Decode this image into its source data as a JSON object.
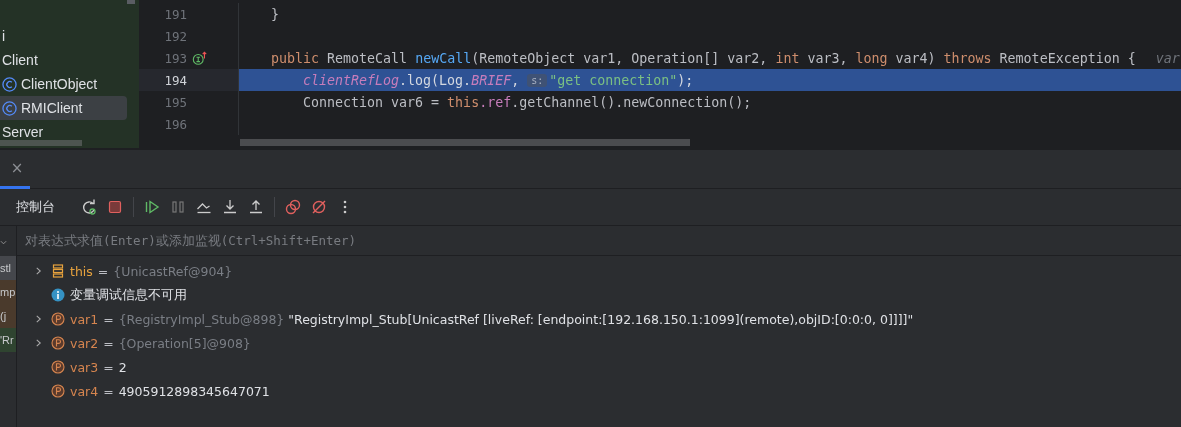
{
  "project_tree": {
    "items": [
      {
        "label": "i",
        "kind": "package",
        "selected": false
      },
      {
        "label": "Client",
        "kind": "package",
        "selected": false
      },
      {
        "label": "ClientObject",
        "kind": "class",
        "selected": false
      },
      {
        "label": "RMIClient",
        "kind": "class",
        "selected": true
      },
      {
        "label": "Server",
        "kind": "package",
        "selected": false
      }
    ]
  },
  "editor": {
    "lines": [
      {
        "number": "191",
        "current": false,
        "marker": false,
        "indent": false,
        "tokens": [
          {
            "kind": "plain",
            "text": "}"
          }
        ]
      },
      {
        "number": "192",
        "current": false,
        "marker": false,
        "indent": false
      },
      {
        "number": "193",
        "current": false,
        "marker": true,
        "indent": false,
        "tokens": [
          {
            "kind": "keyword",
            "text": "public"
          },
          {
            "kind": "plain",
            "text": " RemoteCall "
          },
          {
            "kind": "method",
            "text": "newCall"
          },
          {
            "kind": "plain",
            "text": "(RemoteObject var1, Operation[] var2, "
          },
          {
            "kind": "keyword",
            "text": "int"
          },
          {
            "kind": "plain",
            "text": " var3, "
          },
          {
            "kind": "keyword",
            "text": "long"
          },
          {
            "kind": "plain",
            "text": " var4) "
          },
          {
            "kind": "keyword",
            "text": "throws"
          },
          {
            "kind": "plain",
            "text": " RemoteException {"
          },
          {
            "kind": "hint",
            "text": "var"
          }
        ]
      },
      {
        "number": "194",
        "current": true,
        "marker": false,
        "indent": true,
        "tokens": [
          {
            "kind": "static",
            "text": "clientRefLog"
          },
          {
            "kind": "plain",
            "text": ".log(Log."
          },
          {
            "kind": "static",
            "text": "BRIEF"
          },
          {
            "kind": "plain",
            "text": ", "
          },
          {
            "kind": "badge",
            "text": "s:"
          },
          {
            "kind": "string",
            "text": "\"get connection\""
          },
          {
            "kind": "plain",
            "text": ");"
          }
        ]
      },
      {
        "number": "195",
        "current": false,
        "marker": false,
        "indent": true,
        "tokens": [
          {
            "kind": "plain",
            "text": "Connection var6 = "
          },
          {
            "kind": "keyword",
            "text": "this"
          },
          {
            "kind": "field",
            "text": ".ref"
          },
          {
            "kind": "plain",
            "text": ".getChannel().newConnection();"
          }
        ]
      },
      {
        "number": "196",
        "current": false,
        "marker": false,
        "indent": false
      }
    ]
  },
  "debug_panel": {
    "close": "×",
    "console_tab": "控制台",
    "evaluate_field": {
      "placeholder": "对表达式求值(Enter)或添加监视(Ctrl+Shift+Enter)"
    },
    "frames": [
      {
        "label": "stl",
        "color": "#45474c"
      },
      {
        "label": "mp",
        "color": "#4a3a2c"
      },
      {
        "label": "(j",
        "color": "#4a3a2c"
      },
      {
        "label": "'Rr",
        "color": "#2f4430"
      }
    ],
    "variables": [
      {
        "kind": "object",
        "expandable": true,
        "name": "this",
        "equals": "=",
        "type": "{UnicastRef@904}"
      },
      {
        "kind": "info",
        "expandable": false,
        "name": "变量调试信息不可用"
      },
      {
        "kind": "param",
        "expandable": true,
        "name": "var1",
        "equals": "=",
        "type": "{RegistryImpl_Stub@898}",
        "value": "\"RegistryImpl_Stub[UnicastRef [liveRef: [endpoint:[192.168.150.1:1099](remote),objID:[0:0:0, 0]]]]\""
      },
      {
        "kind": "param",
        "expandable": true,
        "name": "var2",
        "equals": "=",
        "type": "{Operation[5]@908}"
      },
      {
        "kind": "param",
        "expandable": false,
        "name": "var3",
        "equals": "=",
        "value": "2"
      },
      {
        "kind": "param",
        "expandable": false,
        "name": "var4",
        "equals": "=",
        "value": "4905912898345647071"
      }
    ]
  }
}
